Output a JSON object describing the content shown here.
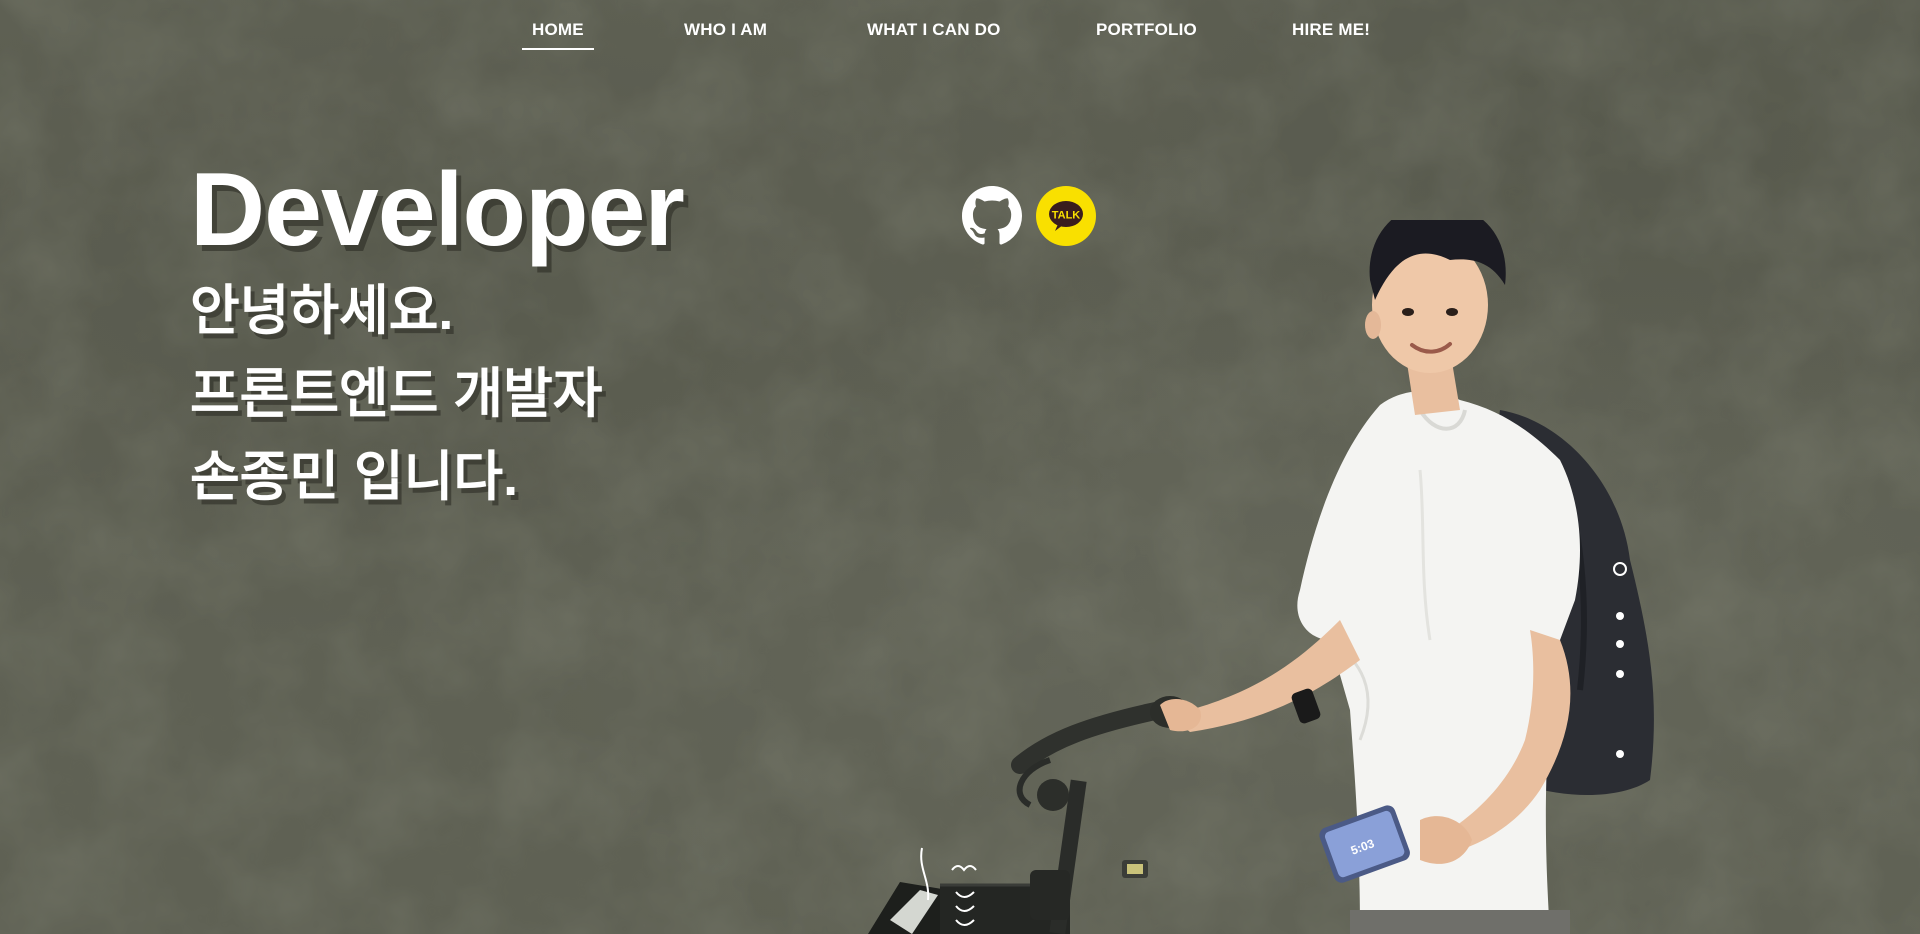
{
  "nav": {
    "items": [
      {
        "label": "HOME",
        "active": true
      },
      {
        "label": "WHO I AM",
        "active": false
      },
      {
        "label": "WHAT I CAN DO",
        "active": false
      },
      {
        "label": "PORTFOLIO",
        "active": false
      },
      {
        "label": "HIRE ME!",
        "active": false
      }
    ]
  },
  "hero": {
    "title": "Developer",
    "lines": [
      "안녕하세요.",
      "프론트엔드 개발자",
      "손종민 입니다."
    ]
  },
  "social": {
    "github_icon": "github-icon",
    "kakao_icon": "kakaotalk-icon",
    "kakao_label": "TALK",
    "kakao_color": "#f9e000"
  },
  "photo": {
    "phone_time": "5:03"
  },
  "colors": {
    "background": "#5f6154",
    "text": "#ffffff"
  },
  "scroll_dots": {
    "count": 5,
    "active_index": 0
  }
}
